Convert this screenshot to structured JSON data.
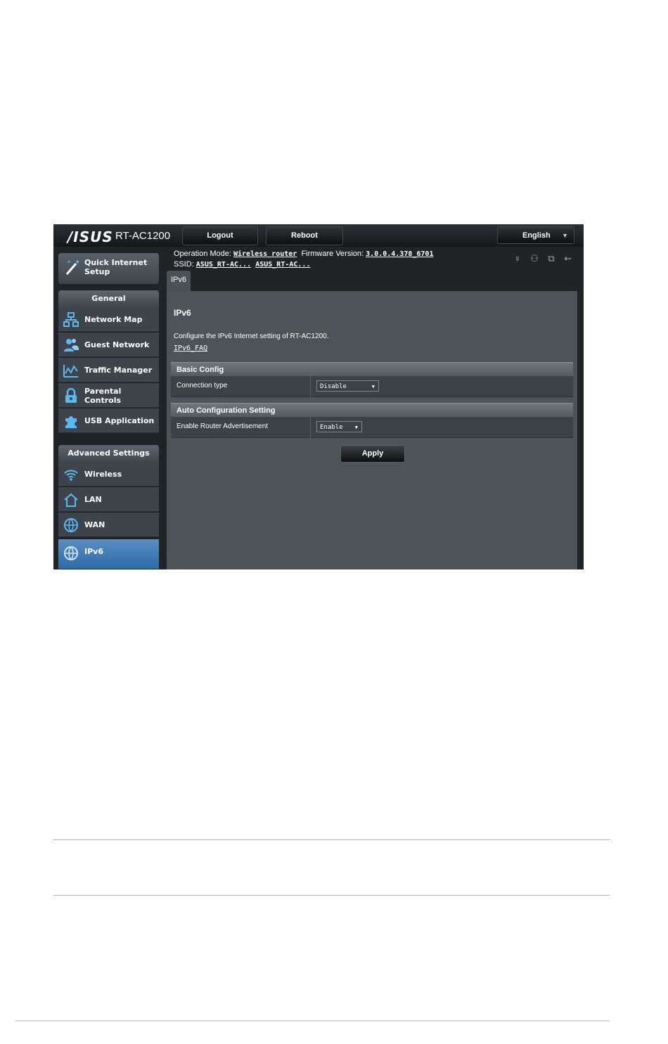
{
  "header": {
    "brand": "/ISUS",
    "model": "RT-AC1200",
    "logout_label": "Logout",
    "reboot_label": "Reboot",
    "language": "English"
  },
  "sidebar": {
    "quick_setup": "Quick Internet Setup",
    "general_title": "General",
    "general_items": [
      {
        "label": "Network Map",
        "icon": "network-map-icon"
      },
      {
        "label": "Guest Network",
        "icon": "guest-network-icon"
      },
      {
        "label": "Traffic Manager",
        "icon": "traffic-manager-icon"
      },
      {
        "label": "Parental Controls",
        "icon": "lock-icon"
      },
      {
        "label": "USB Application",
        "icon": "puzzle-icon"
      }
    ],
    "advanced_title": "Advanced Settings",
    "advanced_items": [
      {
        "label": "Wireless",
        "icon": "wifi-icon"
      },
      {
        "label": "LAN",
        "icon": "home-icon"
      },
      {
        "label": "WAN",
        "icon": "globe-icon"
      },
      {
        "label": "IPv6",
        "icon": "ipv6-globe-icon",
        "active": true
      }
    ]
  },
  "status": {
    "mode_label": "Operation Mode:",
    "mode_value": "Wireless router",
    "firmware_label": "Firmware Version:",
    "firmware_value": "3.0.0.4.378_6701",
    "ssid_label": "SSID:",
    "ssid_1": "ASUS_RT-AC...",
    "ssid_2": "ASUS_RT-AC..."
  },
  "tab": "IPv6",
  "main": {
    "title": "IPv6",
    "description": "Configure the IPv6 Internet setting of RT-AC1200.",
    "faq_link": "IPv6_FAQ",
    "basic_config": {
      "header": "Basic Config",
      "row_label": "Connection type",
      "value": "Disable"
    },
    "auto_config": {
      "header": "Auto Configuration Setting",
      "row_label": "Enable Router Advertisement",
      "value": "Enable"
    },
    "apply_label": "Apply"
  },
  "colors": {
    "accent_active": "#3d78b6",
    "panel_bg": "#4d5459",
    "status_yellow": "#e8c33a"
  }
}
